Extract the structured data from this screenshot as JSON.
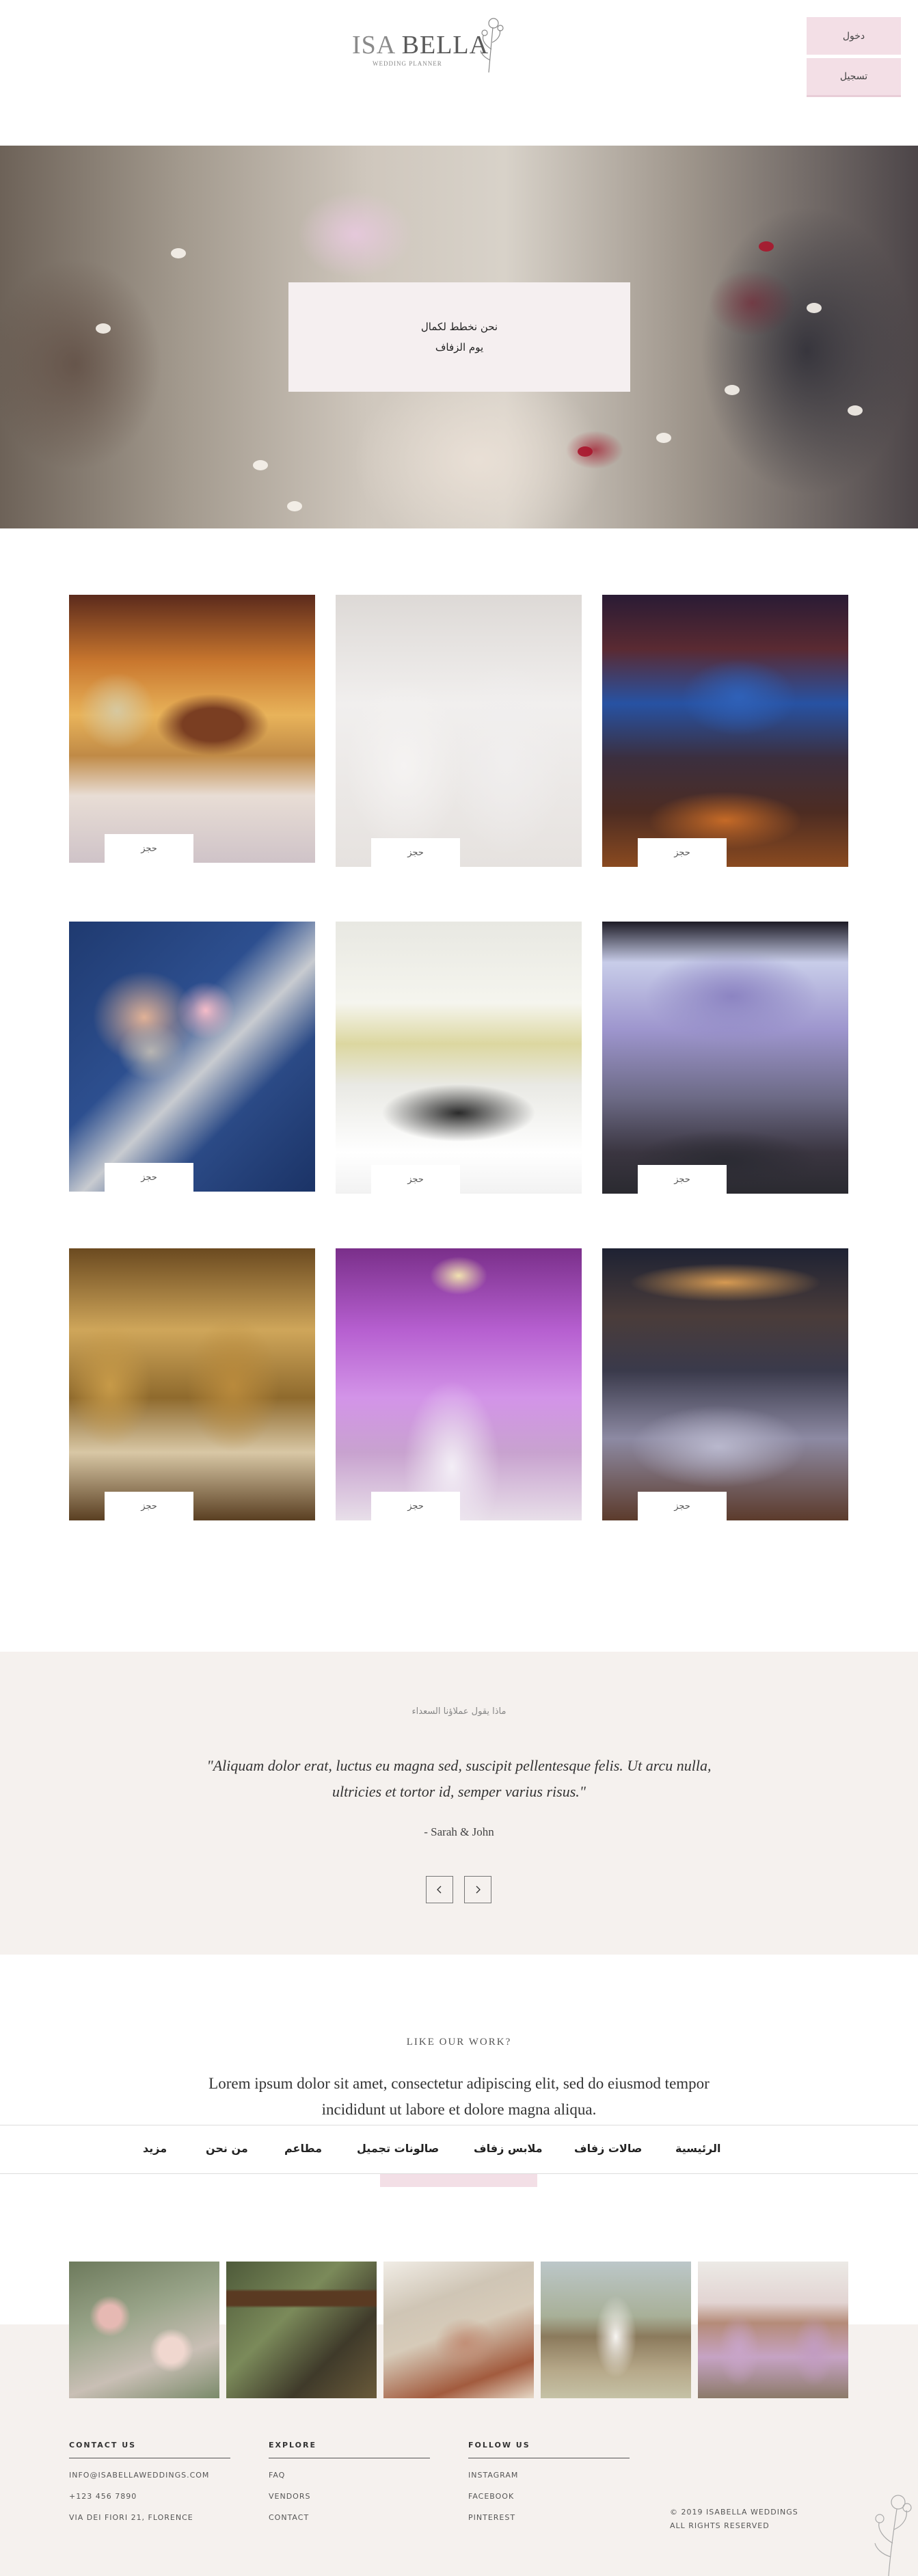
{
  "header": {
    "logo": {
      "main_light": "ISA",
      "main_bold": "BELLA",
      "sub": "WEDDING PLANNER"
    },
    "login_label": "دخول",
    "register_label": "تسجيل"
  },
  "hero": {
    "line1": "نحن نخطط لكمال",
    "line2": "يوم الزفاف"
  },
  "gallery": {
    "items": [
      {
        "label": "حجز"
      },
      {
        "label": "حجز"
      },
      {
        "label": "حجز"
      },
      {
        "label": "حجز"
      },
      {
        "label": "حجز"
      },
      {
        "label": "حجز"
      },
      {
        "label": "حجز"
      },
      {
        "label": "حجز"
      },
      {
        "label": "حجز"
      }
    ]
  },
  "testimonial": {
    "heading": "ماذا يقول عملاؤنا السعداء",
    "quote": "\"Aliquam dolor erat, luctus eu magna sed, suscipit pellentesque felis. Ut arcu nulla, ultricies et tortor id, semper varius risus.\"",
    "author": "- Sarah & John"
  },
  "work": {
    "heading": "LIKE OUR WORK?",
    "text": "Lorem ipsum dolor sit amet, consectetur adipiscing elit, sed do eiusmod tempor incididunt ut labore et dolore magna aliqua."
  },
  "nav": {
    "items": [
      {
        "label": "الرئيسية"
      },
      {
        "label": "صالات زفاف"
      },
      {
        "label": "ملابس زفاف"
      },
      {
        "label": "صالونات تجميل"
      },
      {
        "label": "مطاعم"
      },
      {
        "label": "من نحن"
      },
      {
        "label": "مزيد"
      }
    ]
  },
  "footer": {
    "contact": {
      "title": "CONTACT US",
      "email": "INFO@ISABELLAWEDDINGS.COM",
      "phone": "+123 456 7890",
      "address": "VIA DEI FIORI 21, FLORENCE"
    },
    "explore": {
      "title": "EXPLORE",
      "links": [
        "FAQ",
        "VENDORS",
        "CONTACT"
      ]
    },
    "follow": {
      "title": "FOLLOW US",
      "links": [
        "INSTAGRAM",
        "FACEBOOK",
        "PINTEREST"
      ]
    },
    "copyright": {
      "line1": "© 2019 ISABELLA WEDDINGS",
      "line2": "ALL RIGHTS RESERVED"
    }
  },
  "icons": {
    "prev": "chevron-left-icon",
    "next": "chevron-right-icon",
    "logo_flower": "flower-sketch-icon"
  },
  "colors": {
    "accent_pink": "#f3dfe6",
    "section_beige": "#f5f1ee",
    "hero_card": "#f5eff0"
  }
}
